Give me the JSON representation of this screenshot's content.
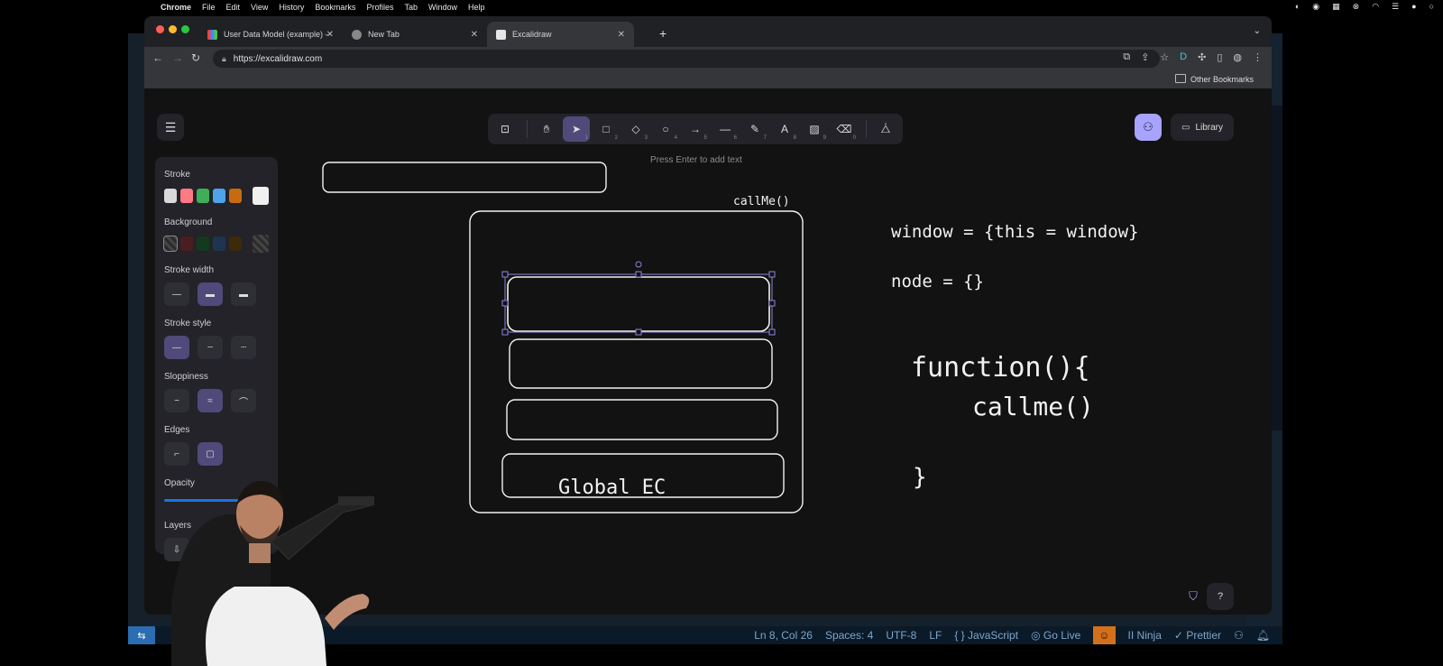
{
  "menubar": {
    "apple": "",
    "app": "Chrome",
    "items": [
      "File",
      "Edit",
      "View",
      "History",
      "Bookmarks",
      "Profiles",
      "Tab",
      "Window",
      "Help"
    ]
  },
  "browser": {
    "tabs": [
      {
        "title": "User Data Model (example) – ",
        "active": false
      },
      {
        "title": "New Tab",
        "active": false
      },
      {
        "title": "Excalidraw",
        "active": true
      }
    ],
    "url": "https://excalidraw.com",
    "bookmarks_folder": "Other Bookmarks"
  },
  "excalidraw": {
    "hint": "Press Enter to add text",
    "library_label": "Library",
    "tools": [
      {
        "icon": "lock-icon",
        "key": ""
      },
      {
        "icon": "hand-icon",
        "key": ""
      },
      {
        "icon": "selection-icon",
        "key": "1",
        "selected": true
      },
      {
        "icon": "rectangle-icon",
        "key": "2"
      },
      {
        "icon": "diamond-icon",
        "key": "3"
      },
      {
        "icon": "ellipse-icon",
        "key": "4"
      },
      {
        "icon": "arrow-icon",
        "key": "5"
      },
      {
        "icon": "line-icon",
        "key": "6"
      },
      {
        "icon": "pencil-icon",
        "key": "7"
      },
      {
        "icon": "text-icon",
        "key": "8"
      },
      {
        "icon": "image-icon",
        "key": "9"
      },
      {
        "icon": "eraser-icon",
        "key": "0"
      },
      {
        "icon": "extra-tools-icon",
        "key": ""
      }
    ],
    "props": {
      "stroke_label": "Stroke",
      "background_label": "Background",
      "stroke_width_label": "Stroke width",
      "stroke_style_label": "Stroke style",
      "sloppiness_label": "Sloppiness",
      "edges_label": "Edges",
      "opacity_label": "Opacity",
      "opacity_value": 1.0,
      "layers_label": "Layers",
      "stroke_colors": [
        "#d9d9d9",
        "#ff7a85",
        "#3fae59",
        "#4fa3e8",
        "#c86b10"
      ],
      "stroke_current": "#f0f0f0",
      "background_colors": [
        "#2a2a2a",
        "#4a1d22",
        "#123a1e",
        "#1d3550",
        "#3d2a08"
      ]
    },
    "canvas_text": {
      "callme_small": "callMe()",
      "window_line": "window = {this = window}",
      "node_line": "node = {}",
      "function_line": "function(){",
      "callme_line": "callme()",
      "closing_brace": "}",
      "global_ec": "Global EC"
    }
  },
  "vscode_status": {
    "position": "Ln 8, Col 26",
    "spaces": "Spaces: 4",
    "encoding": "UTF-8",
    "eol": "LF",
    "language": "JavaScript",
    "golive": "Go Live",
    "ninja": "Ninja",
    "prettier": "Prettier"
  },
  "colors": {
    "accent": "#a8a3ff",
    "selected_tool": "#4f4a7a",
    "canvas_bg": "#121212",
    "vscode_status_bg": "#0b1a28"
  }
}
